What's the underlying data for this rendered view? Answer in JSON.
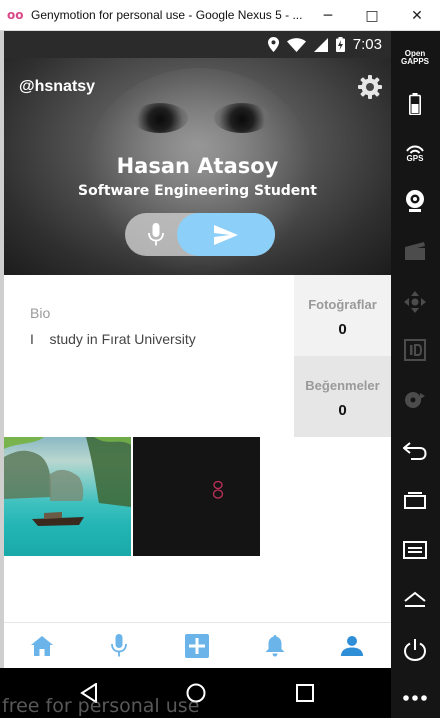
{
  "window": {
    "title": "Genymotion for personal use - Google Nexus 5 - ...",
    "minimize_glyph": "─",
    "maximize_glyph": "□",
    "close_glyph": "✕"
  },
  "statusbar": {
    "time": "7:03",
    "icons": [
      "location-icon",
      "wifi-icon",
      "signal-icon",
      "battery-charging-icon"
    ]
  },
  "profile": {
    "handle": "@hsnatsy",
    "name": "Hasan Atasoy",
    "subtitle": "Software Engineering Student",
    "bio_label": "Bio",
    "bio_text": "I    study in Fırat University"
  },
  "stats": [
    {
      "label": "Fotoğraflar",
      "value": "0"
    },
    {
      "label": "Beğenmeler",
      "value": "0"
    }
  ],
  "bottom_nav": {
    "items": [
      "home-icon",
      "mic-icon",
      "add-icon",
      "bell-icon",
      "profile-icon"
    ],
    "active": "profile-icon"
  },
  "sidebar": {
    "gapps_label": "Open\nGAPPS",
    "gps_label": "GPS"
  },
  "watermark": "free for personal use",
  "colors": {
    "accent": "#8ccff8",
    "nav_icon": "#6ab4ea",
    "stats_bg_1": "#f2f2f2",
    "stats_bg_2": "#e6e6e6"
  }
}
